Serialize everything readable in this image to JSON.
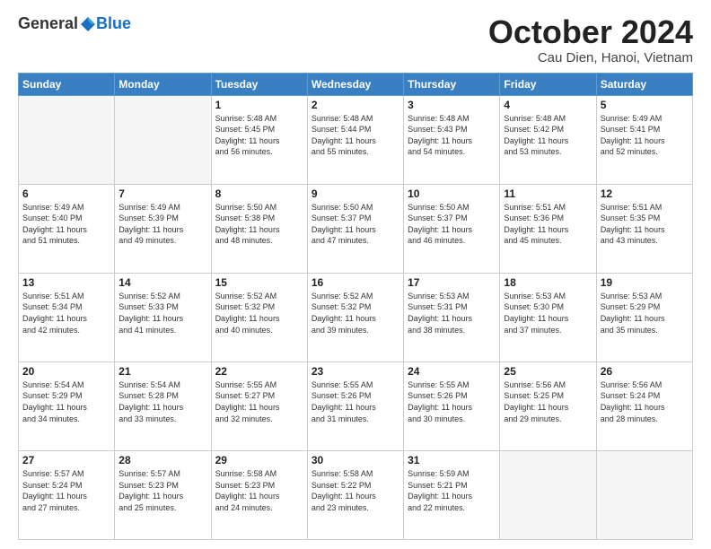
{
  "header": {
    "logo_general": "General",
    "logo_blue": "Blue",
    "month": "October 2024",
    "location": "Cau Dien, Hanoi, Vietnam"
  },
  "weekdays": [
    "Sunday",
    "Monday",
    "Tuesday",
    "Wednesday",
    "Thursday",
    "Friday",
    "Saturday"
  ],
  "weeks": [
    [
      {
        "day": "",
        "info": ""
      },
      {
        "day": "",
        "info": ""
      },
      {
        "day": "1",
        "info": "Sunrise: 5:48 AM\nSunset: 5:45 PM\nDaylight: 11 hours\nand 56 minutes."
      },
      {
        "day": "2",
        "info": "Sunrise: 5:48 AM\nSunset: 5:44 PM\nDaylight: 11 hours\nand 55 minutes."
      },
      {
        "day": "3",
        "info": "Sunrise: 5:48 AM\nSunset: 5:43 PM\nDaylight: 11 hours\nand 54 minutes."
      },
      {
        "day": "4",
        "info": "Sunrise: 5:48 AM\nSunset: 5:42 PM\nDaylight: 11 hours\nand 53 minutes."
      },
      {
        "day": "5",
        "info": "Sunrise: 5:49 AM\nSunset: 5:41 PM\nDaylight: 11 hours\nand 52 minutes."
      }
    ],
    [
      {
        "day": "6",
        "info": "Sunrise: 5:49 AM\nSunset: 5:40 PM\nDaylight: 11 hours\nand 51 minutes."
      },
      {
        "day": "7",
        "info": "Sunrise: 5:49 AM\nSunset: 5:39 PM\nDaylight: 11 hours\nand 49 minutes."
      },
      {
        "day": "8",
        "info": "Sunrise: 5:50 AM\nSunset: 5:38 PM\nDaylight: 11 hours\nand 48 minutes."
      },
      {
        "day": "9",
        "info": "Sunrise: 5:50 AM\nSunset: 5:37 PM\nDaylight: 11 hours\nand 47 minutes."
      },
      {
        "day": "10",
        "info": "Sunrise: 5:50 AM\nSunset: 5:37 PM\nDaylight: 11 hours\nand 46 minutes."
      },
      {
        "day": "11",
        "info": "Sunrise: 5:51 AM\nSunset: 5:36 PM\nDaylight: 11 hours\nand 45 minutes."
      },
      {
        "day": "12",
        "info": "Sunrise: 5:51 AM\nSunset: 5:35 PM\nDaylight: 11 hours\nand 43 minutes."
      }
    ],
    [
      {
        "day": "13",
        "info": "Sunrise: 5:51 AM\nSunset: 5:34 PM\nDaylight: 11 hours\nand 42 minutes."
      },
      {
        "day": "14",
        "info": "Sunrise: 5:52 AM\nSunset: 5:33 PM\nDaylight: 11 hours\nand 41 minutes."
      },
      {
        "day": "15",
        "info": "Sunrise: 5:52 AM\nSunset: 5:32 PM\nDaylight: 11 hours\nand 40 minutes."
      },
      {
        "day": "16",
        "info": "Sunrise: 5:52 AM\nSunset: 5:32 PM\nDaylight: 11 hours\nand 39 minutes."
      },
      {
        "day": "17",
        "info": "Sunrise: 5:53 AM\nSunset: 5:31 PM\nDaylight: 11 hours\nand 38 minutes."
      },
      {
        "day": "18",
        "info": "Sunrise: 5:53 AM\nSunset: 5:30 PM\nDaylight: 11 hours\nand 37 minutes."
      },
      {
        "day": "19",
        "info": "Sunrise: 5:53 AM\nSunset: 5:29 PM\nDaylight: 11 hours\nand 35 minutes."
      }
    ],
    [
      {
        "day": "20",
        "info": "Sunrise: 5:54 AM\nSunset: 5:29 PM\nDaylight: 11 hours\nand 34 minutes."
      },
      {
        "day": "21",
        "info": "Sunrise: 5:54 AM\nSunset: 5:28 PM\nDaylight: 11 hours\nand 33 minutes."
      },
      {
        "day": "22",
        "info": "Sunrise: 5:55 AM\nSunset: 5:27 PM\nDaylight: 11 hours\nand 32 minutes."
      },
      {
        "day": "23",
        "info": "Sunrise: 5:55 AM\nSunset: 5:26 PM\nDaylight: 11 hours\nand 31 minutes."
      },
      {
        "day": "24",
        "info": "Sunrise: 5:55 AM\nSunset: 5:26 PM\nDaylight: 11 hours\nand 30 minutes."
      },
      {
        "day": "25",
        "info": "Sunrise: 5:56 AM\nSunset: 5:25 PM\nDaylight: 11 hours\nand 29 minutes."
      },
      {
        "day": "26",
        "info": "Sunrise: 5:56 AM\nSunset: 5:24 PM\nDaylight: 11 hours\nand 28 minutes."
      }
    ],
    [
      {
        "day": "27",
        "info": "Sunrise: 5:57 AM\nSunset: 5:24 PM\nDaylight: 11 hours\nand 27 minutes."
      },
      {
        "day": "28",
        "info": "Sunrise: 5:57 AM\nSunset: 5:23 PM\nDaylight: 11 hours\nand 25 minutes."
      },
      {
        "day": "29",
        "info": "Sunrise: 5:58 AM\nSunset: 5:23 PM\nDaylight: 11 hours\nand 24 minutes."
      },
      {
        "day": "30",
        "info": "Sunrise: 5:58 AM\nSunset: 5:22 PM\nDaylight: 11 hours\nand 23 minutes."
      },
      {
        "day": "31",
        "info": "Sunrise: 5:59 AM\nSunset: 5:21 PM\nDaylight: 11 hours\nand 22 minutes."
      },
      {
        "day": "",
        "info": ""
      },
      {
        "day": "",
        "info": ""
      }
    ]
  ]
}
